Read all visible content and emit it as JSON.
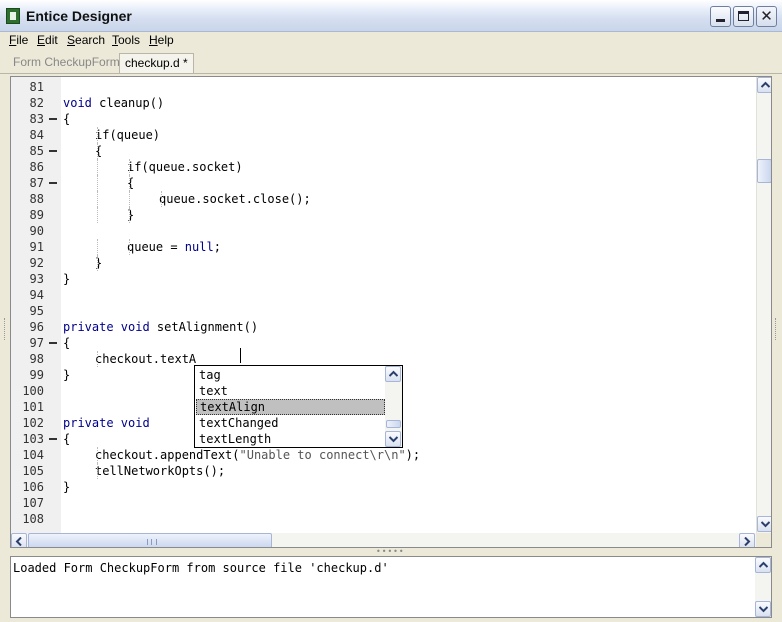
{
  "window": {
    "title": "Entice Designer"
  },
  "menu": [
    "File",
    "Edit",
    "Search",
    "Tools",
    "Help"
  ],
  "tabs": [
    {
      "label": "Form CheckupForm *",
      "active": false
    },
    {
      "label": "checkup.d *",
      "active": true
    }
  ],
  "code_lines": [
    {
      "num": "81",
      "fold": false,
      "text": ""
    },
    {
      "num": "82",
      "fold": false,
      "indent": 1,
      "kw": "void",
      "text": " cleanup()"
    },
    {
      "num": "83",
      "fold": true,
      "indent": 1,
      "text": "{"
    },
    {
      "num": "84",
      "fold": false,
      "indent": 2,
      "text": "if(queue)"
    },
    {
      "num": "85",
      "fold": true,
      "indent": 2,
      "text": "{"
    },
    {
      "num": "86",
      "fold": false,
      "indent": 3,
      "text": "if(queue.socket)"
    },
    {
      "num": "87",
      "fold": true,
      "indent": 3,
      "text": "{"
    },
    {
      "num": "88",
      "fold": false,
      "indent": 4,
      "text": "queue.socket.close();"
    },
    {
      "num": "89",
      "fold": false,
      "indent": 3,
      "text": "}"
    },
    {
      "num": "90",
      "fold": false,
      "text": ""
    },
    {
      "num": "91",
      "fold": false,
      "indent": 3,
      "text": "queue = ",
      "kw2": "null",
      "tail": ";"
    },
    {
      "num": "92",
      "fold": false,
      "indent": 2,
      "text": "}"
    },
    {
      "num": "93",
      "fold": false,
      "indent": 1,
      "text": "}"
    },
    {
      "num": "94",
      "fold": false,
      "text": ""
    },
    {
      "num": "95",
      "fold": false,
      "text": ""
    },
    {
      "num": "96",
      "fold": false,
      "indent": 1,
      "kw": "private void",
      "text": " setAlignment()"
    },
    {
      "num": "97",
      "fold": true,
      "indent": 1,
      "text": "{"
    },
    {
      "num": "98",
      "fold": false,
      "indent": 2,
      "text": "checkout.textA"
    },
    {
      "num": "99",
      "fold": false,
      "indent": 1,
      "text": "}"
    },
    {
      "num": "100",
      "fold": false,
      "text": ""
    },
    {
      "num": "101",
      "fold": false,
      "text": ""
    },
    {
      "num": "102",
      "fold": false,
      "indent": 1,
      "kw": "private void",
      "text": ""
    },
    {
      "num": "103",
      "fold": true,
      "indent": 1,
      "text": "{"
    },
    {
      "num": "104",
      "fold": false,
      "indent": 2,
      "text": "checkout.appendText(",
      "str": "\"Unable to connect\\r\\n\"",
      "tail": ");"
    },
    {
      "num": "105",
      "fold": false,
      "indent": 2,
      "text": "tellNetworkOpts();"
    },
    {
      "num": "106",
      "fold": false,
      "indent": 1,
      "text": "}"
    },
    {
      "num": "107",
      "fold": false,
      "text": ""
    },
    {
      "num": "108",
      "fold": false,
      "text": ""
    }
  ],
  "autocomplete": {
    "items": [
      "tag",
      "text",
      "textAlign",
      "textChanged",
      "textLength"
    ],
    "selected_index": 2
  },
  "output": {
    "text": "Loaded Form CheckupForm from source file 'checkup.d'"
  },
  "icons": {
    "scroll_up": "arrow-up-icon",
    "scroll_down": "arrow-down-icon",
    "scroll_left": "arrow-left-icon",
    "scroll_right": "arrow-right-icon"
  },
  "colors": {
    "keyword": "#00008b",
    "selection": "#c0c0c0"
  }
}
